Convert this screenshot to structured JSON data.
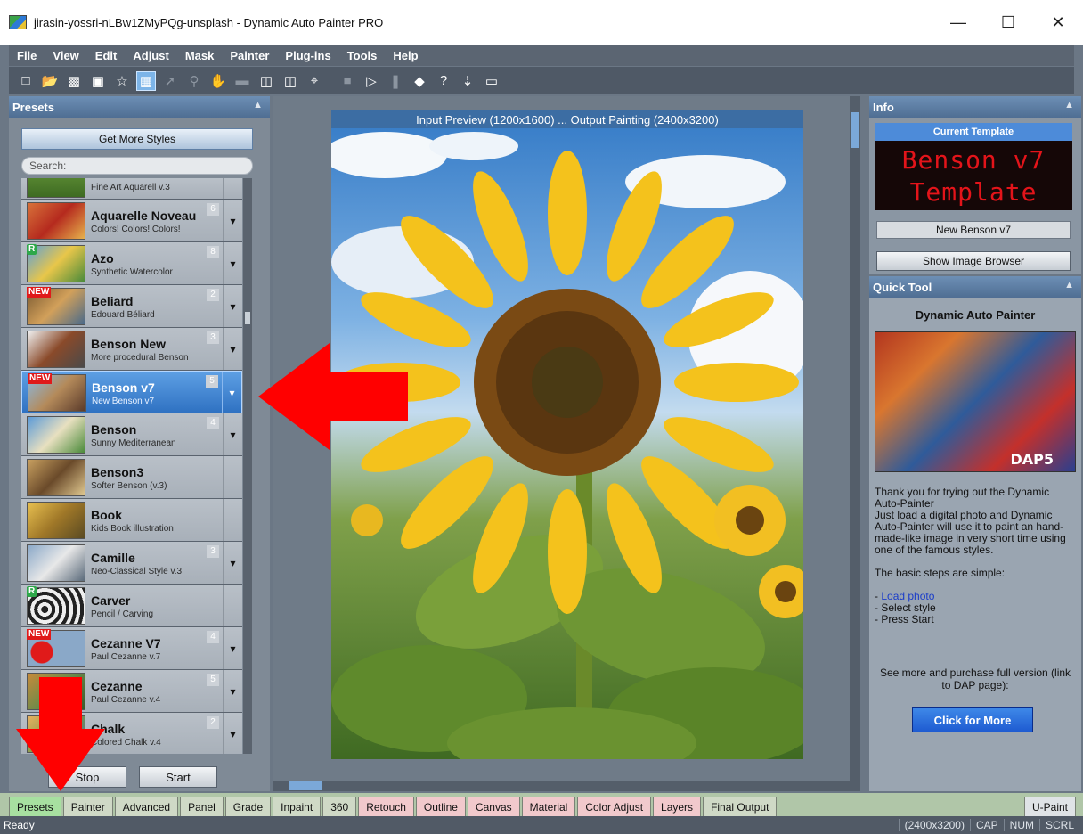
{
  "window": {
    "title": "jirasin-yossri-nLBw1ZMyPQg-unsplash - Dynamic Auto Painter PRO",
    "controls": [
      "—",
      "☐",
      "✕"
    ]
  },
  "menu": [
    "File",
    "View",
    "Edit",
    "Adjust",
    "Mask",
    "Painter",
    "Plug-ins",
    "Tools",
    "Help"
  ],
  "presets_panel": {
    "title": "Presets",
    "get_more": "Get More Styles",
    "search_placeholder": "Search:",
    "items": [
      {
        "name": "",
        "desc": "Fine Art Aquarell v.3",
        "num": "",
        "badge": ""
      },
      {
        "name": "Aquarelle Noveau",
        "desc": "Colors! Colors! Colors!",
        "num": "6",
        "badge": ""
      },
      {
        "name": "Azo",
        "desc": "Synthetic Watercolor",
        "num": "8",
        "badge": "R"
      },
      {
        "name": "Beliard",
        "desc": "Edouard Béliard",
        "num": "2",
        "badge": "NEW"
      },
      {
        "name": "Benson New",
        "desc": "More procedural Benson",
        "num": "3",
        "badge": ""
      },
      {
        "name": "Benson v7",
        "desc": "New Benson v7",
        "num": "5",
        "badge": "NEW"
      },
      {
        "name": "Benson",
        "desc": "Sunny Mediterranean",
        "num": "4",
        "badge": ""
      },
      {
        "name": "Benson3",
        "desc": "Softer Benson (v.3)",
        "num": "",
        "badge": ""
      },
      {
        "name": "Book",
        "desc": "Kids Book illustration",
        "num": "",
        "badge": ""
      },
      {
        "name": "Camille",
        "desc": "Neo-Classical Style v.3",
        "num": "3",
        "badge": ""
      },
      {
        "name": "Carver",
        "desc": "Pencil / Carving",
        "num": "",
        "badge": "R"
      },
      {
        "name": "Cezanne V7",
        "desc": "Paul Cezanne v.7",
        "num": "4",
        "badge": "NEW"
      },
      {
        "name": "Cezanne",
        "desc": "Paul Cezanne v.4",
        "num": "5",
        "badge": ""
      },
      {
        "name": "Chalk",
        "desc": "Colored Chalk v.4",
        "num": "2",
        "badge": ""
      }
    ],
    "stop": "Stop",
    "start": "Start"
  },
  "canvas": {
    "preview_title": "Input Preview (1200x1600) ... Output Painting (2400x3200)"
  },
  "info_panel": {
    "title": "Info",
    "current_template_label": "Current Template",
    "led_line1": "Benson v7",
    "led_line2": "Template",
    "template_name": "New Benson v7",
    "show_browser": "Show Image Browser"
  },
  "quick_tool": {
    "title": "Quick Tool",
    "heading": "Dynamic Auto Painter",
    "image_label": "DAP5",
    "para1": "Thank you for trying out the Dynamic Auto-Painter",
    "para2": "Just load a digital photo and Dynamic Auto-Painter will use it to paint an hand-made-like image in very short time using one of the famous styles.",
    "para3": "The basic steps are simple:",
    "step1": "Load photo",
    "step1_prefix": "- ",
    "step2": "- Select style",
    "step3": "- Press Start",
    "see_more": "See more and purchase full version (link to DAP page):",
    "click_more": "Click for More"
  },
  "tabs": {
    "items": [
      {
        "label": "Presets",
        "style": "active"
      },
      {
        "label": "Painter",
        "style": ""
      },
      {
        "label": "Advanced",
        "style": ""
      },
      {
        "label": "Panel",
        "style": ""
      },
      {
        "label": "Grade",
        "style": ""
      },
      {
        "label": "Inpaint",
        "style": ""
      },
      {
        "label": "360",
        "style": ""
      },
      {
        "label": "Retouch",
        "style": "pink"
      },
      {
        "label": "Outline",
        "style": "pink"
      },
      {
        "label": "Canvas",
        "style": "pink"
      },
      {
        "label": "Material",
        "style": "pink"
      },
      {
        "label": "Color Adjust",
        "style": "pink"
      },
      {
        "label": "Layers",
        "style": "pink"
      },
      {
        "label": "Final Output",
        "style": ""
      }
    ],
    "uPaint": "U-Paint"
  },
  "status": {
    "text": "Ready",
    "size": "(2400x3200)",
    "cap": "CAP",
    "num": "NUM",
    "scrl": "SCRL"
  },
  "colors": {
    "selected_preset": "#2f72c2",
    "annotation_arrow": "#ff0000",
    "led_text": "#e3141a"
  }
}
